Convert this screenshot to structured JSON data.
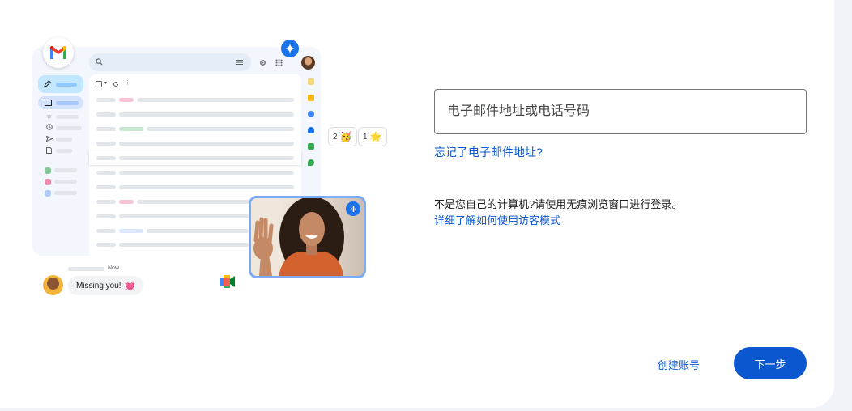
{
  "colors": {
    "page_background": "#f0f4f9",
    "card_background": "#ffffff",
    "primary": "#0b57d0",
    "field_border": "#747775",
    "text": "#1f1f1f"
  },
  "illustration": {
    "logo_icon": "gmail-logo-icon",
    "assistant_icon": "sparkle-icon",
    "reactions": [
      {
        "count": "2",
        "emoji": "🥳"
      },
      {
        "count": "1",
        "emoji": "🌟"
      }
    ],
    "chat": {
      "time": "Now",
      "message": "Missing you!",
      "emoji": "💓"
    },
    "video_call_icon": "google-meet-icon",
    "mic_icon": "audio-wave-icon"
  },
  "form": {
    "email_placeholder": "电子邮件地址或电话号码",
    "email_value": "",
    "forgot_email_link": "忘记了电子邮件地址?",
    "guest_notice": "不是您自己的计算机?请使用无痕浏览窗口进行登录。",
    "guest_mode_link": "详细了解如何使用访客模式"
  },
  "actions": {
    "create_account": "创建账号",
    "next": "下一步"
  }
}
